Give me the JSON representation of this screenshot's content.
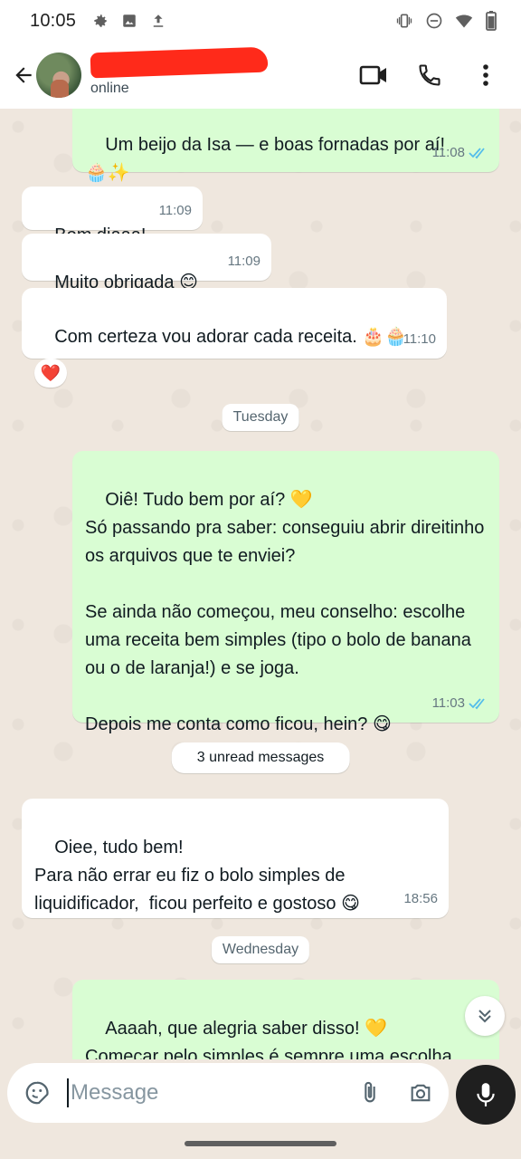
{
  "status_bar": {
    "time": "10:05",
    "left_icons": [
      "gear-icon",
      "image-icon",
      "upload-icon"
    ],
    "right_icons": [
      "vibrate-icon",
      "do-not-disturb-icon",
      "wifi-icon",
      "battery-icon"
    ]
  },
  "header": {
    "contact_name_redacted": true,
    "contact_status": "online",
    "actions": [
      "video-call-icon",
      "voice-call-icon",
      "more-options-icon"
    ]
  },
  "messages": [
    {
      "direction": "out",
      "text": "Um beijo da Isa — e boas fornadas por aí!\n🧁✨",
      "time": "11:08",
      "read": true
    },
    {
      "direction": "in",
      "text": "Bom diaaa!",
      "time": "11:09"
    },
    {
      "direction": "in",
      "text": "Muito obrigada 😊",
      "time": "11:09"
    },
    {
      "direction": "in",
      "text": "Com certeza vou adorar cada receita. 🎂🧁",
      "time": "11:10",
      "reaction": "❤️"
    },
    {
      "direction": "out",
      "text": "Oiê! Tudo bem por aí? 💛\nSó passando pra saber: conseguiu abrir direitinho os arquivos que te enviei?\n\nSe ainda não começou, meu conselho: escolhe uma receita bem simples (tipo o bolo de banana ou o de laranja!) e se joga.\n\nDepois me conta como ficou, hein? 😋",
      "time": "11:03",
      "read": true
    },
    {
      "direction": "in",
      "text": "Oiee, tudo bem!\nPara não errar eu fiz o bolo simples de liquidificador,  ficou perfeito e gostoso 😋",
      "time": "18:56"
    },
    {
      "direction": "out",
      "text": "Aaaah, que alegria saber disso! 💛\nComeçar pelo simples é sempre uma escolha sábia — e que bom que já deu certo"
    }
  ],
  "dividers": {
    "tuesday": "Tuesday",
    "unread": "3 unread messages",
    "wednesday": "Wednesday"
  },
  "composer": {
    "placeholder": "Message",
    "value": ""
  },
  "colors": {
    "outgoing_bubble": "#d9fdd3",
    "incoming_bubble": "#ffffff",
    "chat_background": "#efe7de",
    "read_ticks": "#53bdeb",
    "redaction": "#ff2a1a"
  }
}
